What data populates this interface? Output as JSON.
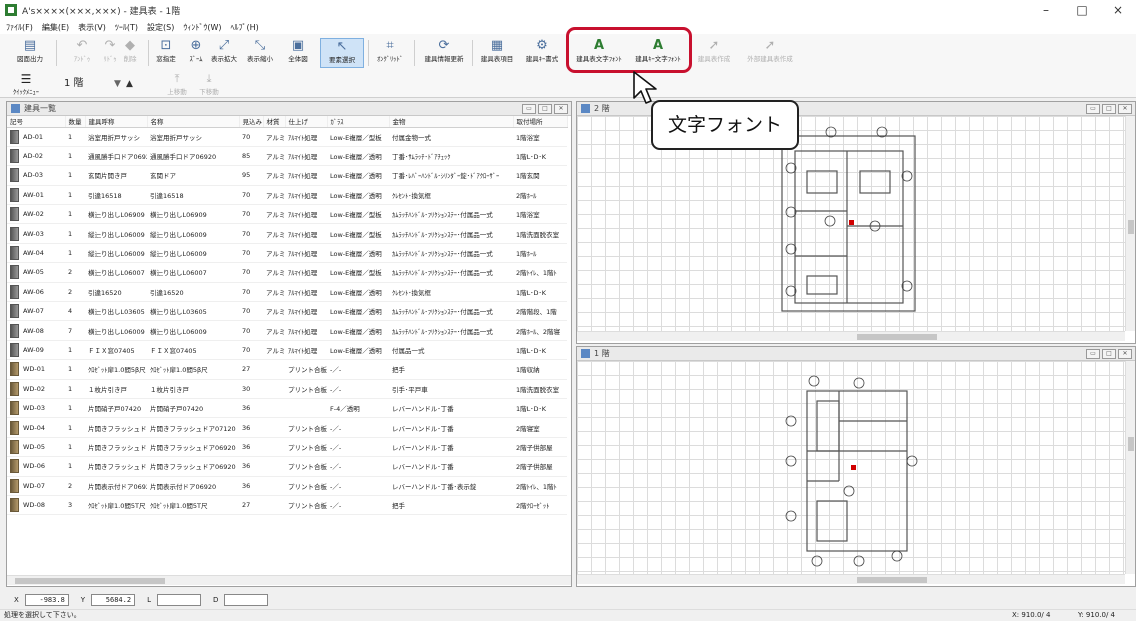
{
  "window": {
    "title": "A's××××(×××,×××) - 建具表 - 1階",
    "minimize": "–",
    "maximize": "□",
    "close": "×"
  },
  "menu": [
    "ﾌｧｲﾙ(F)",
    "編集(E)",
    "表示(V)",
    "ﾂｰﾙ(T)",
    "設定(S)",
    "ｳｨﾝﾄﾞｳ(W)",
    "ﾍﾙﾌﾟ(H)"
  ],
  "toolbar": {
    "row1": [
      {
        "label": "図面出力",
        "icon": "print-icon",
        "glyph": "▤",
        "enabled": true
      },
      {
        "label": "ｱﾝﾄﾞｩ",
        "icon": "undo-icon",
        "glyph": "↶",
        "enabled": false
      },
      {
        "label": "ﾘﾄﾞｩ",
        "icon": "redo-icon",
        "glyph": "↷",
        "enabled": false
      },
      {
        "label": "削除",
        "icon": "eraser-icon",
        "glyph": "◆",
        "enabled": false
      },
      {
        "label": "窓指定",
        "icon": "window-select-icon",
        "glyph": "⊡",
        "enabled": true
      },
      {
        "label": "ｽﾞｰﾑ",
        "icon": "zoom-icon",
        "glyph": "⊕",
        "enabled": true
      },
      {
        "label": "表示拡大",
        "icon": "zoom-in-icon",
        "glyph": "⤢",
        "enabled": true
      },
      {
        "label": "表示縮小",
        "icon": "zoom-out-icon",
        "glyph": "⤡",
        "enabled": true
      },
      {
        "label": "全体図",
        "icon": "whole-view-icon",
        "glyph": "▣",
        "enabled": true
      },
      {
        "label": "要素選択",
        "icon": "select-arrow-icon",
        "glyph": "↖",
        "enabled": true,
        "active": true
      },
      {
        "label": "ｵﾝｸﾞﾘｯﾄﾞ",
        "icon": "on-grid-icon",
        "glyph": "⌗",
        "enabled": true
      },
      {
        "label": "建具情報更新",
        "icon": "update-info-icon",
        "glyph": "⟳",
        "enabled": true
      },
      {
        "label": "建具表項目",
        "icon": "table-items-icon",
        "glyph": "▦",
        "enabled": true
      },
      {
        "label": "建具ｷｰ書式",
        "icon": "key-format-icon",
        "glyph": "⚙",
        "enabled": true
      },
      {
        "label": "建具表文字ﾌｫﾝﾄ",
        "icon": "table-font-icon",
        "glyph": "A",
        "enabled": true
      },
      {
        "label": "建具ｷｰ文字ﾌｫﾝﾄ",
        "icon": "key-font-icon",
        "glyph": "A",
        "enabled": true
      },
      {
        "label": "建具表作成",
        "icon": "create-table-icon",
        "glyph": "➚",
        "enabled": false
      },
      {
        "label": "外部建具表作成",
        "icon": "create-external-table-icon",
        "glyph": "➚",
        "enabled": false
      }
    ],
    "quick_menu": "ｸｲｯｸﾒﾆｭｰ",
    "floor": "1 階",
    "move_up": "上移動",
    "move_down": "下移動"
  },
  "annotation": {
    "callout_text": "文字フォント"
  },
  "list_panel": {
    "title": "建具一覧",
    "columns": [
      "記号",
      "数量",
      "建具呼称",
      "名称",
      "見込み",
      "材質",
      "仕上げ",
      "ｶﾞﾗｽ",
      "金物",
      "取付場所"
    ],
    "rows": [
      [
        "AD-01",
        "1",
        "浴室用折戸サッシ",
        "浴室用折戸サッシ",
        "70",
        "アルミ",
        "ｱﾙﾏｲﾄ処理",
        "Low-E複層／型板",
        "付属金物一式",
        "1階浴室"
      ],
      [
        "AD-02",
        "1",
        "通風勝手口ドア06920",
        "通風勝手口ドア06920",
        "85",
        "アルミ",
        "ｱﾙﾏｲﾄ処理",
        "Low-E複層／透明",
        "丁番･ｻﾑﾗｯﾁ･ﾄﾞｱﾁｪｯｸ",
        "1階L･D･K"
      ],
      [
        "AD-03",
        "1",
        "玄関片開き戸",
        "玄関ドア",
        "95",
        "アルミ",
        "ｱﾙﾏｲﾄ処理",
        "Low-E複層／透明",
        "丁番･ﾚﾊﾞｰﾊﾝﾄﾞﾙ･ｼﾘﾝﾀﾞｰ錠･ﾄﾞｱｸﾛｰｻﾞｰ",
        "1階玄関"
      ],
      [
        "AW-01",
        "1",
        "引違16518",
        "引違16518",
        "70",
        "アルミ",
        "ｱﾙﾏｲﾄ処理",
        "Low-E複層／透明",
        "ｸﾚｾﾝﾄ･換気框",
        "2階ﾎｰﾙ"
      ],
      [
        "AW-02",
        "1",
        "横辷り出しL06909",
        "横辷り出しL06909",
        "70",
        "アルミ",
        "ｱﾙﾏｲﾄ処理",
        "Low-E複層／型板",
        "ｶﾑﾗｯﾁﾊﾝﾄﾞﾙ･ﾌﾘｸｼｮﾝｽﾃｰ･付属品一式",
        "1階浴室"
      ],
      [
        "AW-03",
        "1",
        "縦辷り出しL06009",
        "縦辷り出しL06009",
        "70",
        "アルミ",
        "ｱﾙﾏｲﾄ処理",
        "Low-E複層／型板",
        "ｶﾑﾗｯﾁﾊﾝﾄﾞﾙ･ﾌﾘｸｼｮﾝｽﾃｰ･付属品一式",
        "1階洗面脱衣室"
      ],
      [
        "AW-04",
        "1",
        "縦辷り出しL06009",
        "縦辷り出しL06009",
        "70",
        "アルミ",
        "ｱﾙﾏｲﾄ処理",
        "Low-E複層／透明",
        "ｶﾑﾗｯﾁﾊﾝﾄﾞﾙ･ﾌﾘｸｼｮﾝｽﾃｰ･付属品一式",
        "1階ﾎｰﾙ"
      ],
      [
        "AW-05",
        "2",
        "横辷り出しL06007",
        "横辷り出しL06007",
        "70",
        "アルミ",
        "ｱﾙﾏｲﾄ処理",
        "Low-E複層／型板",
        "ｶﾑﾗｯﾁﾊﾝﾄﾞﾙ･ﾌﾘｸｼｮﾝｽﾃｰ･付属品一式",
        "2階ﾄｲﾚ、1階ﾄ"
      ],
      [
        "AW-06",
        "2",
        "引違16520",
        "引違16520",
        "70",
        "アルミ",
        "ｱﾙﾏｲﾄ処理",
        "Low-E複層／透明",
        "ｸﾚｾﾝﾄ･換気框",
        "1階L･D･K"
      ],
      [
        "AW-07",
        "4",
        "横辷り出しL03605",
        "横辷り出しL03605",
        "70",
        "アルミ",
        "ｱﾙﾏｲﾄ処理",
        "Low-E複層／透明",
        "ｶﾑﾗｯﾁﾊﾝﾄﾞﾙ･ﾌﾘｸｼｮﾝｽﾃｰ･付属品一式",
        "2階階段、1階"
      ],
      [
        "AW-08",
        "7",
        "横辷り出しL06009",
        "横辷り出しL06009",
        "70",
        "アルミ",
        "ｱﾙﾏｲﾄ処理",
        "Low-E複層／透明",
        "ｶﾑﾗｯﾁﾊﾝﾄﾞﾙ･ﾌﾘｸｼｮﾝｽﾃｰ･付属品一式",
        "2階ﾎｰﾙ、2階寝"
      ],
      [
        "AW-09",
        "1",
        "ＦＩＸ窓07405",
        "ＦＩＸ窓07405",
        "70",
        "アルミ",
        "ｱﾙﾏｲﾄ処理",
        "Low-E複層／透明",
        "付属品一式",
        "1階L･D･K"
      ],
      [
        "WD-01",
        "1",
        "ｸﾛｾﾞｯﾄ扉1.0間5β尺",
        "ｸﾛｾﾞｯﾄ扉1.0間5β尺",
        "27",
        "",
        "プリント合板",
        "-／-",
        "把手",
        "1階収納"
      ],
      [
        "WD-02",
        "1",
        "１枚片引き戸",
        "１枚片引き戸",
        "30",
        "",
        "プリント合板",
        "-／-",
        "引手･平戸車",
        "1階洗面脱衣室"
      ],
      [
        "WD-03",
        "1",
        "片開硝子戸07420",
        "片開硝子戸07420",
        "36",
        "",
        "",
        "F-4／透明",
        "レバーハンドル･丁番",
        "1階L･D･K"
      ],
      [
        "WD-04",
        "1",
        "片開きフラッシュドア07120",
        "片開きフラッシュドア07120",
        "36",
        "",
        "プリント合板",
        "-／-",
        "レバーハンドル･丁番",
        "2階寝室"
      ],
      [
        "WD-05",
        "1",
        "片開きフラッシュドア06920",
        "片開きフラッシュドア06920",
        "36",
        "",
        "プリント合板",
        "-／-",
        "レバーハンドル･丁番",
        "2階子供部屋"
      ],
      [
        "WD-06",
        "1",
        "片開きフラッシュドア06920",
        "片開きフラッシュドア06920",
        "36",
        "",
        "プリント合板",
        "-／-",
        "レバーハンドル･丁番",
        "2階子供部屋"
      ],
      [
        "WD-07",
        "2",
        "片開表示付ドア06920",
        "片開表示付ドア06920",
        "36",
        "",
        "プリント合板",
        "-／-",
        "レバーハンドル･丁番･表示錠",
        "2階ﾄｲﾚ、1階ﾄ"
      ],
      [
        "WD-08",
        "3",
        "ｸﾛｾﾞｯﾄ扉1.0間5T尺",
        "ｸﾛｾﾞｯﾄ扉1.0間5T尺",
        "27",
        "",
        "プリント合板",
        "-／-",
        "把手",
        "2階ｸﾛｰｾﾞｯﾄ"
      ]
    ]
  },
  "floor2_panel": {
    "title": "2 階"
  },
  "floor1_panel": {
    "title": "1 階"
  },
  "coords": {
    "x_label": "X",
    "x_value": "-983.8",
    "y_label": "Y",
    "y_value": "5684.2",
    "l_label": "L",
    "l_value": "",
    "d_label": "D",
    "d_value": ""
  },
  "status": {
    "message": "処理を選択して下さい。",
    "x_readout": "X: 910.0/ 4",
    "y_readout": "Y: 910.0/ 4"
  }
}
